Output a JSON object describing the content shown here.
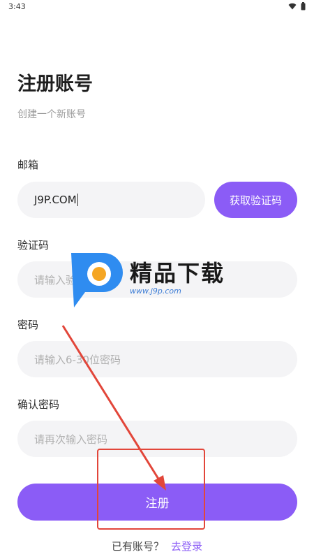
{
  "status_bar": {
    "time": "3:43",
    "icons": [
      "wifi-icon",
      "battery-icon"
    ]
  },
  "header": {
    "title": "注册账号",
    "subtitle": "创建一个新账号"
  },
  "form": {
    "email": {
      "label": "邮箱",
      "value": "J9P.COM"
    },
    "get_code_button": "获取验证码",
    "code": {
      "label": "验证码",
      "placeholder": "请输入验证码"
    },
    "password": {
      "label": "密码",
      "placeholder": "请输入6-30位密码"
    },
    "confirm": {
      "label": "确认密码",
      "placeholder": "请再次输入密码"
    },
    "submit_label": "注册"
  },
  "footer": {
    "prompt": "已有账号？",
    "login_link": "去登录"
  },
  "watermark": {
    "name": "精品下载",
    "url": "www.j9p.com"
  },
  "colors": {
    "accent": "#8b5cf6",
    "input_bg": "#f4f4f6",
    "annotation": "#e2463a"
  }
}
